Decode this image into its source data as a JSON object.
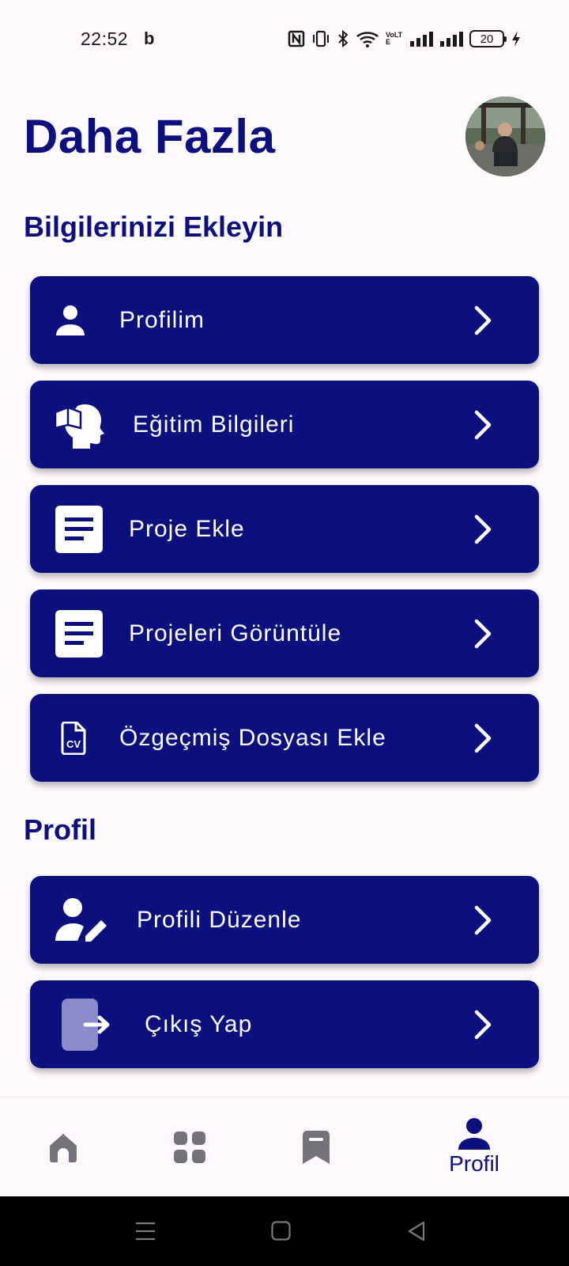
{
  "status_bar": {
    "time": "22:52",
    "carrier_icon": "b",
    "network_label": "VoLTE",
    "battery": "20"
  },
  "header": {
    "title": "Daha Fazla"
  },
  "sections": [
    {
      "title": "Bilgilerinizi Ekleyin"
    },
    {
      "title": "Profil"
    }
  ],
  "menu": [
    {
      "label": "Profilim",
      "icon": "person-icon"
    },
    {
      "label": "Eğitim Bilgileri",
      "icon": "education-icon"
    },
    {
      "label": "Proje Ekle",
      "icon": "document-icon"
    },
    {
      "label": "Projeleri Görüntüle",
      "icon": "document-icon"
    },
    {
      "label": "Özgeçmiş Dosyası Ekle",
      "icon": "cv-file-icon"
    },
    {
      "label": "Profili Düzenle",
      "icon": "user-edit-icon"
    },
    {
      "label": "Çıkış Yap",
      "icon": "logout-icon"
    }
  ],
  "bottom_nav": [
    {
      "name": "home",
      "icon": "home-icon",
      "label": ""
    },
    {
      "name": "grid",
      "icon": "grid-icon",
      "label": ""
    },
    {
      "name": "bookmarks",
      "icon": "bookmark-icon",
      "label": ""
    },
    {
      "name": "profile",
      "icon": "person-icon",
      "label": "Profil",
      "active": true
    }
  ],
  "colors": {
    "primary": "#0c0f7e",
    "background": "#fdf9fd",
    "inactive_icon": "#74737a",
    "card_text": "#ffffff"
  }
}
